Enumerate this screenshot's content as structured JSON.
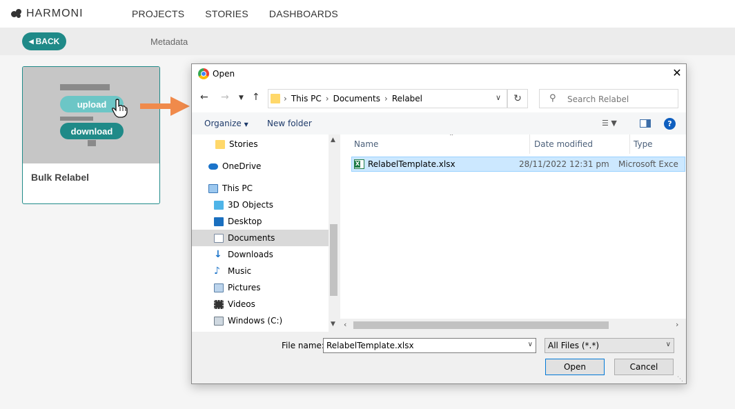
{
  "app": {
    "logo_text": "HARMONI",
    "nav": [
      "PROJECTS",
      "STORIES",
      "DASHBOARDS"
    ]
  },
  "subbar": {
    "back_label": "BACK",
    "label": "Metadata"
  },
  "card": {
    "title": "Bulk Relabel",
    "upload_label": "upload",
    "download_label": "download"
  },
  "dialog": {
    "title": "Open",
    "breadcrumbs": [
      "This PC",
      "Documents",
      "Relabel"
    ],
    "search_placeholder": "Search Relabel",
    "toolbar": {
      "organize": "Organize",
      "new_folder": "New folder"
    },
    "nav_items": [
      {
        "label": "Stories",
        "icon": "folder-icon"
      },
      {
        "label": "OneDrive",
        "icon": "cloud-icon"
      },
      {
        "label": "This PC",
        "icon": "computer-icon"
      },
      {
        "label": "3D Objects",
        "icon": "cube-icon"
      },
      {
        "label": "Desktop",
        "icon": "desktop-icon"
      },
      {
        "label": "Documents",
        "icon": "document-icon"
      },
      {
        "label": "Downloads",
        "icon": "download-icon"
      },
      {
        "label": "Music",
        "icon": "music-icon"
      },
      {
        "label": "Pictures",
        "icon": "picture-icon"
      },
      {
        "label": "Videos",
        "icon": "video-icon"
      },
      {
        "label": "Windows (C:)",
        "icon": "drive-icon"
      }
    ],
    "columns": [
      "Name",
      "Date modified",
      "Type"
    ],
    "files": [
      {
        "name": "RelabelTemplate.xlsx",
        "date": "28/11/2022 12:31 pm",
        "type": "Microsoft Exce",
        "icon": "excel-icon"
      }
    ],
    "file_name_label": "File name:",
    "file_name_value": "RelabelTemplate.xlsx",
    "file_type": "All Files (*.*)",
    "open_label": "Open",
    "cancel_label": "Cancel"
  },
  "colors": {
    "accent": "#1f8a88",
    "upload_pill": "#6cc6c6",
    "arrow": "#f08a4b",
    "selection": "#cce8ff"
  }
}
